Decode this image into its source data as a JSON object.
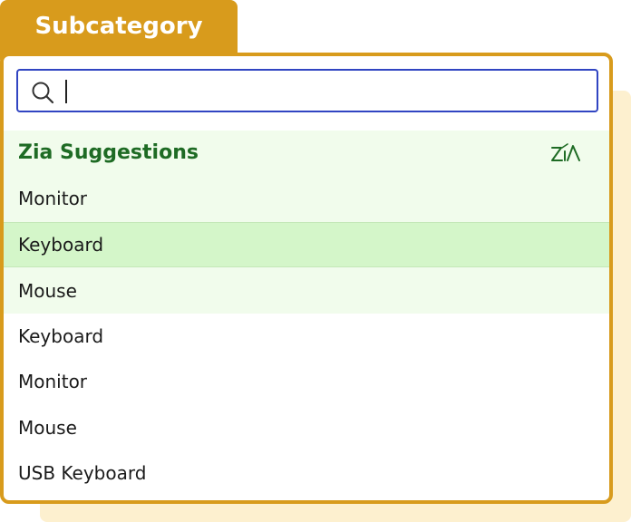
{
  "tab": {
    "label": "Subcategory"
  },
  "search": {
    "value": "",
    "placeholder": ""
  },
  "zia": {
    "title": "Zia Suggestions",
    "icon": "zia-logo-icon",
    "items": [
      {
        "label": "Monitor"
      },
      {
        "label": "Keyboard",
        "highlighted": true
      },
      {
        "label": "Mouse"
      }
    ]
  },
  "items": [
    {
      "label": "Keyboard"
    },
    {
      "label": "Monitor"
    },
    {
      "label": "Mouse"
    },
    {
      "label": "USB Keyboard"
    }
  ],
  "colors": {
    "accent": "#d89b1c",
    "search_border": "#3145c2",
    "zia_background": "#f1fcec",
    "zia_highlight": "#d4f6c9",
    "zia_title": "#1e6b24"
  }
}
